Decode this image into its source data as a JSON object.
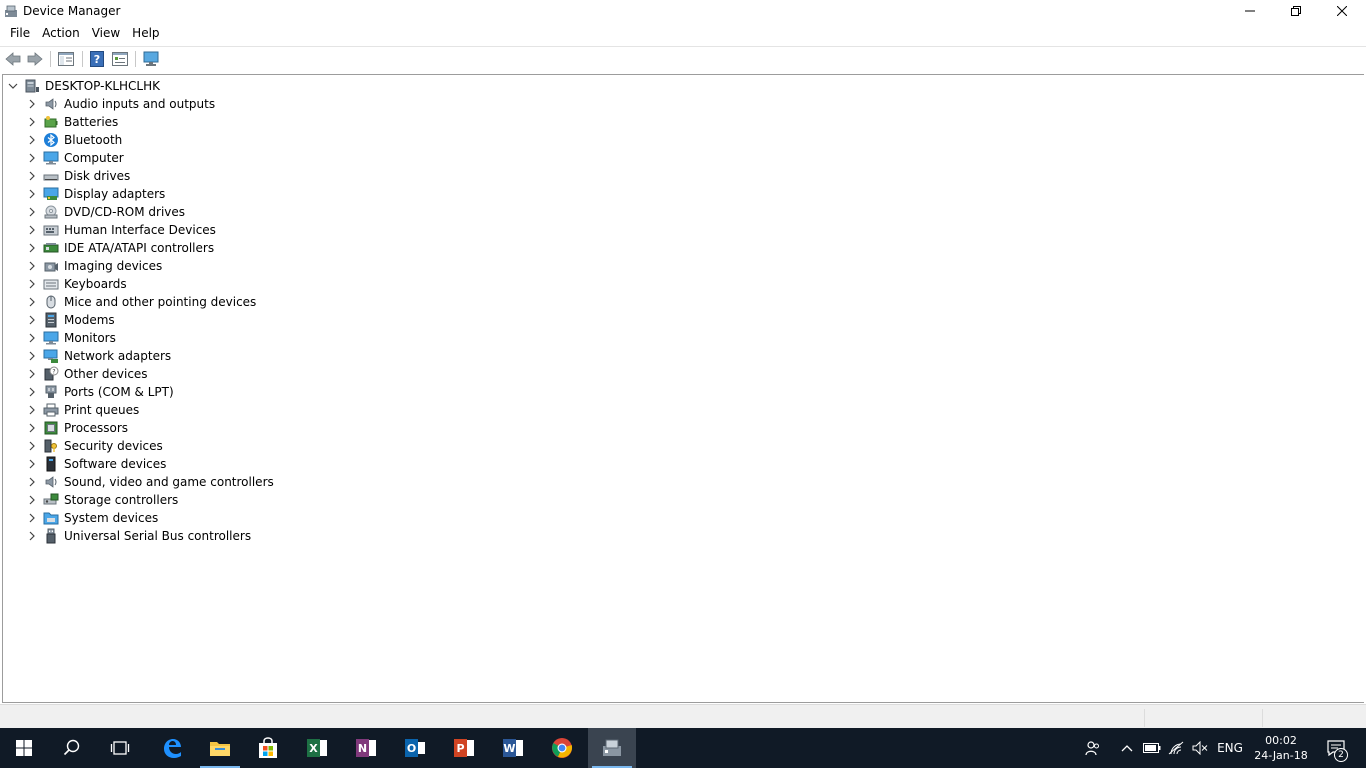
{
  "window": {
    "title": "Device Manager"
  },
  "menu": [
    {
      "label": "File"
    },
    {
      "label": "Action"
    },
    {
      "label": "View"
    },
    {
      "label": "Help"
    }
  ],
  "tree": {
    "root": "DESKTOP-KLHCLHK",
    "items": [
      {
        "label": "Audio inputs and outputs",
        "icon": "speaker-icon"
      },
      {
        "label": "Batteries",
        "icon": "battery-icon"
      },
      {
        "label": "Bluetooth",
        "icon": "bluetooth-icon"
      },
      {
        "label": "Computer",
        "icon": "computer-icon"
      },
      {
        "label": "Disk drives",
        "icon": "disk-drive-icon"
      },
      {
        "label": "Display adapters",
        "icon": "display-adapter-icon"
      },
      {
        "label": "DVD/CD-ROM drives",
        "icon": "dvd-drive-icon"
      },
      {
        "label": "Human Interface Devices",
        "icon": "hid-icon"
      },
      {
        "label": "IDE ATA/ATAPI controllers",
        "icon": "ide-controller-icon"
      },
      {
        "label": "Imaging devices",
        "icon": "camera-icon"
      },
      {
        "label": "Keyboards",
        "icon": "keyboard-icon"
      },
      {
        "label": "Mice and other pointing devices",
        "icon": "mouse-icon"
      },
      {
        "label": "Modems",
        "icon": "modem-icon"
      },
      {
        "label": "Monitors",
        "icon": "monitor-icon"
      },
      {
        "label": "Network adapters",
        "icon": "network-adapter-icon"
      },
      {
        "label": "Other devices",
        "icon": "unknown-device-icon"
      },
      {
        "label": "Ports (COM & LPT)",
        "icon": "port-icon"
      },
      {
        "label": "Print queues",
        "icon": "printer-icon"
      },
      {
        "label": "Processors",
        "icon": "processor-icon"
      },
      {
        "label": "Security devices",
        "icon": "security-key-icon"
      },
      {
        "label": "Software devices",
        "icon": "software-device-icon"
      },
      {
        "label": "Sound, video and game controllers",
        "icon": "sound-icon"
      },
      {
        "label": "Storage controllers",
        "icon": "storage-controller-icon"
      },
      {
        "label": "System devices",
        "icon": "system-folder-icon"
      },
      {
        "label": "Universal Serial Bus controllers",
        "icon": "usb-icon"
      }
    ]
  },
  "taskbar": {
    "language": "ENG",
    "time": "00:02",
    "date": "24-Jan-18",
    "notification_count": "2"
  },
  "colors": {
    "taskbar_bg": "#101a26",
    "accent": "#0078d7",
    "active_underline": "#7ab8ef"
  }
}
